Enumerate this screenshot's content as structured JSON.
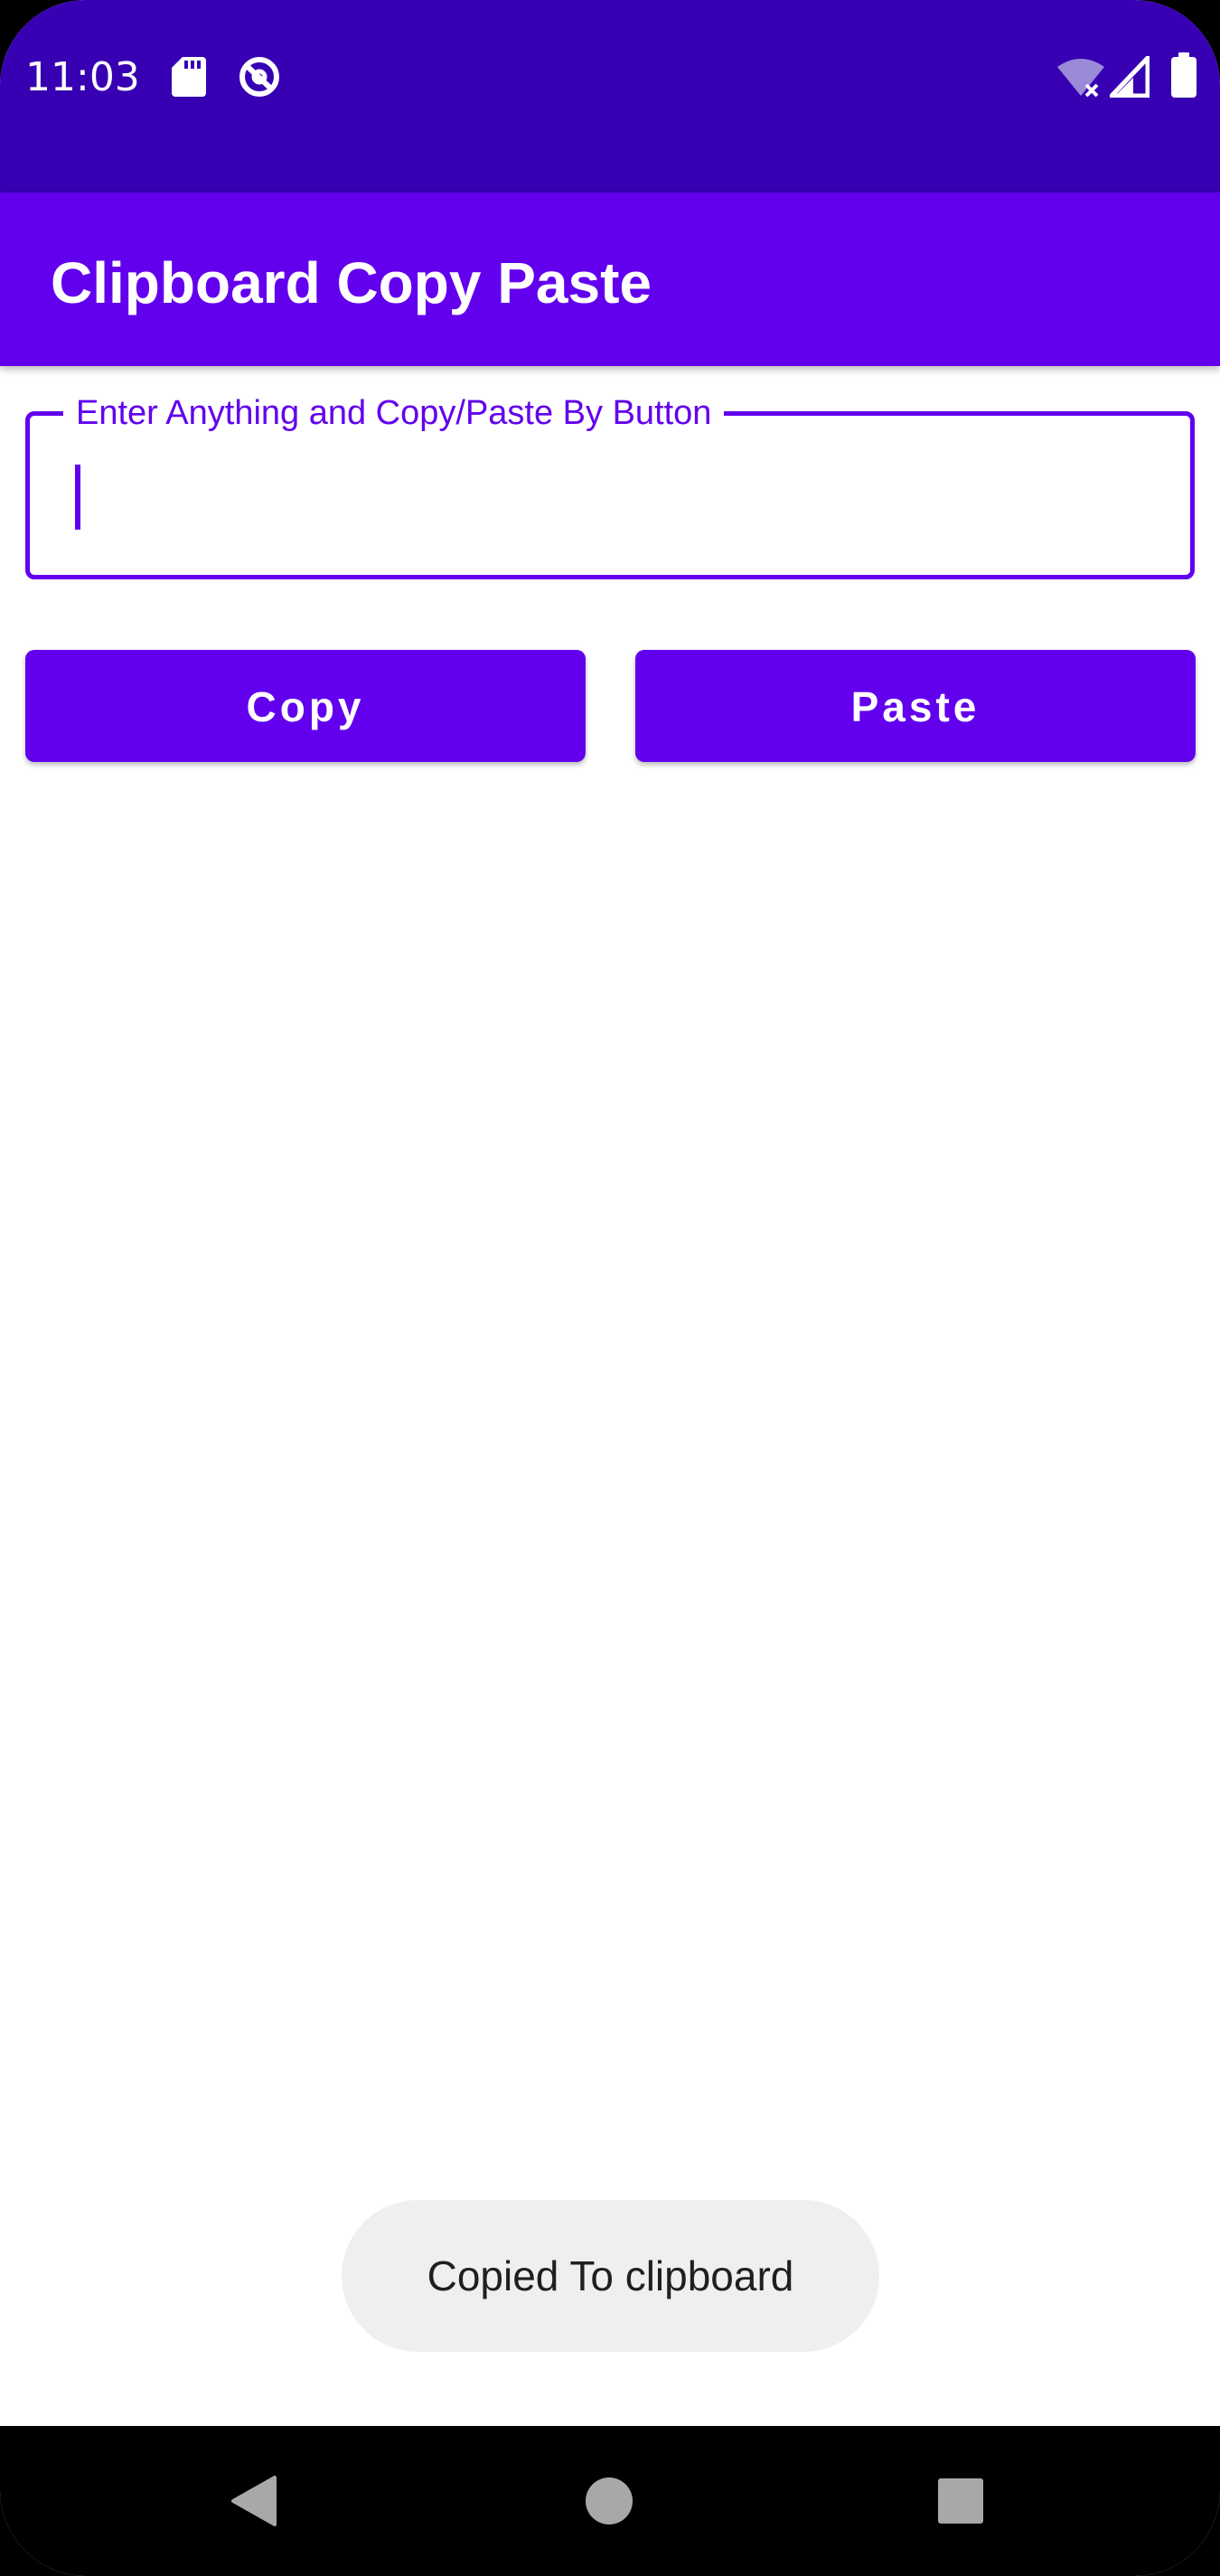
{
  "status_bar": {
    "time": "11:03",
    "left_icons": [
      "sd-card-icon",
      "data-saver-icon"
    ],
    "right_icons": [
      "wifi-icon",
      "signal-icon",
      "battery-icon"
    ]
  },
  "app_bar": {
    "title": "Clipboard Copy Paste"
  },
  "input": {
    "label": "Enter Anything and Copy/Paste By Button",
    "value": ""
  },
  "buttons": {
    "copy_label": "Copy",
    "paste_label": "Paste"
  },
  "toast": {
    "message": "Copied To clipboard"
  },
  "nav_bar": {
    "icons": [
      "back-icon",
      "home-icon",
      "recents-icon"
    ]
  },
  "colors": {
    "status_bar": "#3700b3",
    "primary": "#6200ee",
    "toast_bg": "#efefef"
  }
}
